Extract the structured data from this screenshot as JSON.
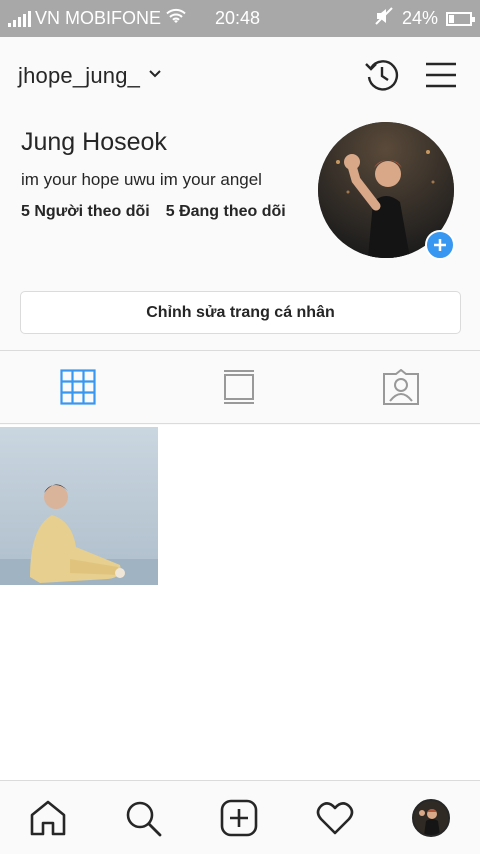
{
  "status_bar": {
    "carrier": "VN MOBIFONE",
    "time": "20:48",
    "battery": "24%",
    "battery_level": 0.24
  },
  "header": {
    "username": "jhope_jung_",
    "icons": [
      "chevron-down-icon",
      "archive-clock-icon",
      "menu-icon"
    ]
  },
  "profile": {
    "name": "Jung Hoseok",
    "bio": "im your hope uwu im your angel",
    "followers": "5 Người theo dõi",
    "following": "5 Đang theo dõi",
    "edit_button": "Chỉnh sửa trang cá nhân"
  },
  "tabs": {
    "items": [
      "grid-icon",
      "feed-icon",
      "tagged-icon"
    ],
    "active": "grid-icon",
    "active_color": "#3897f0"
  },
  "posts": {
    "count": 1
  },
  "bottom_nav": {
    "items": [
      "home-icon",
      "search-icon",
      "new-post-icon",
      "activity-heart-icon",
      "profile-avatar"
    ]
  },
  "colors": {
    "accent": "#3897f0",
    "text": "#262626",
    "border": "#dbdbdb",
    "status_bar": "#a8a8a8"
  }
}
